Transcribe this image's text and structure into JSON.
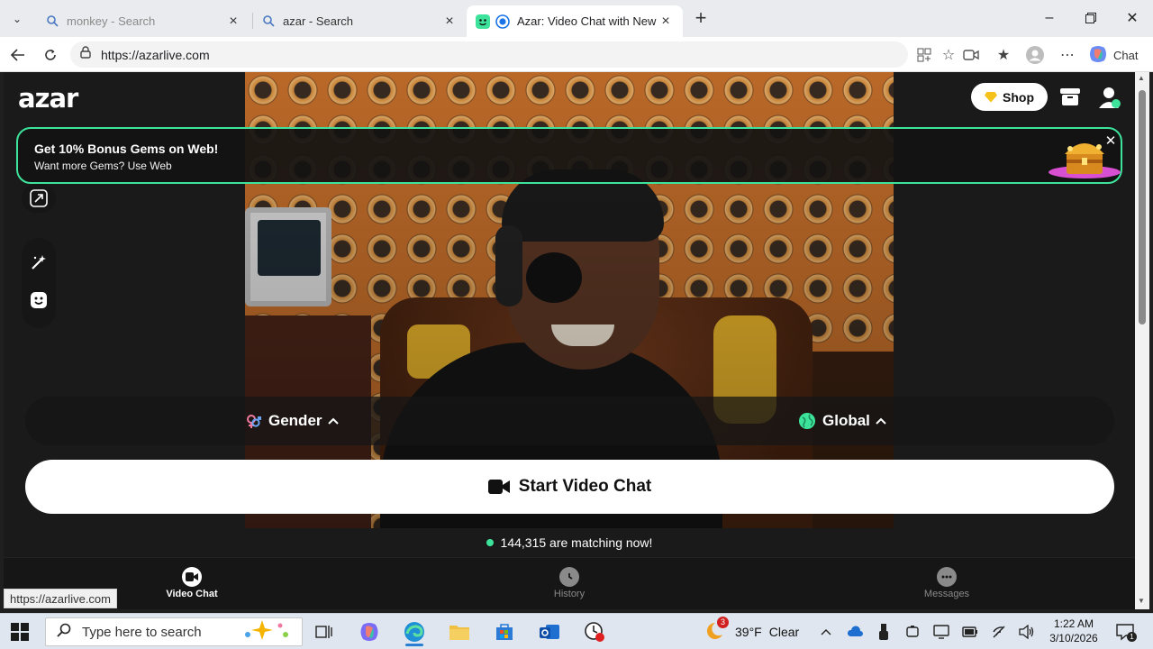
{
  "browser": {
    "tabs": [
      {
        "title": "monkey - Search",
        "icon": "search-icon",
        "active": false
      },
      {
        "title": "azar - Search",
        "icon": "search-icon",
        "active": false
      },
      {
        "title": "Azar: Video Chat with New People",
        "icon": "azar-icon",
        "active": true
      }
    ],
    "url": "https://azarlive.com",
    "chat_label": "Chat"
  },
  "app": {
    "logo": "azar",
    "shop_label": "Shop",
    "promo": {
      "title": "Get 10% Bonus Gems on Web!",
      "subtitle": "Want more Gems? Use Web"
    },
    "filters": {
      "gender_label": "Gender",
      "region_label": "Global"
    },
    "start_button_label": "Start Video Chat",
    "matching_text": "144,315 are matching now!",
    "nav": {
      "video_chat": "Video Chat",
      "history": "History",
      "messages": "Messages"
    },
    "accent_color": "#3de39b"
  },
  "status_bar_url": "https://azarlive.com",
  "taskbar": {
    "search_placeholder": "Type here to search",
    "weather_temp": "39°F",
    "weather_desc": "Clear",
    "weather_badge": "3",
    "time": "1:22 AM",
    "date": "3/10/2026",
    "notification_count": "1"
  }
}
